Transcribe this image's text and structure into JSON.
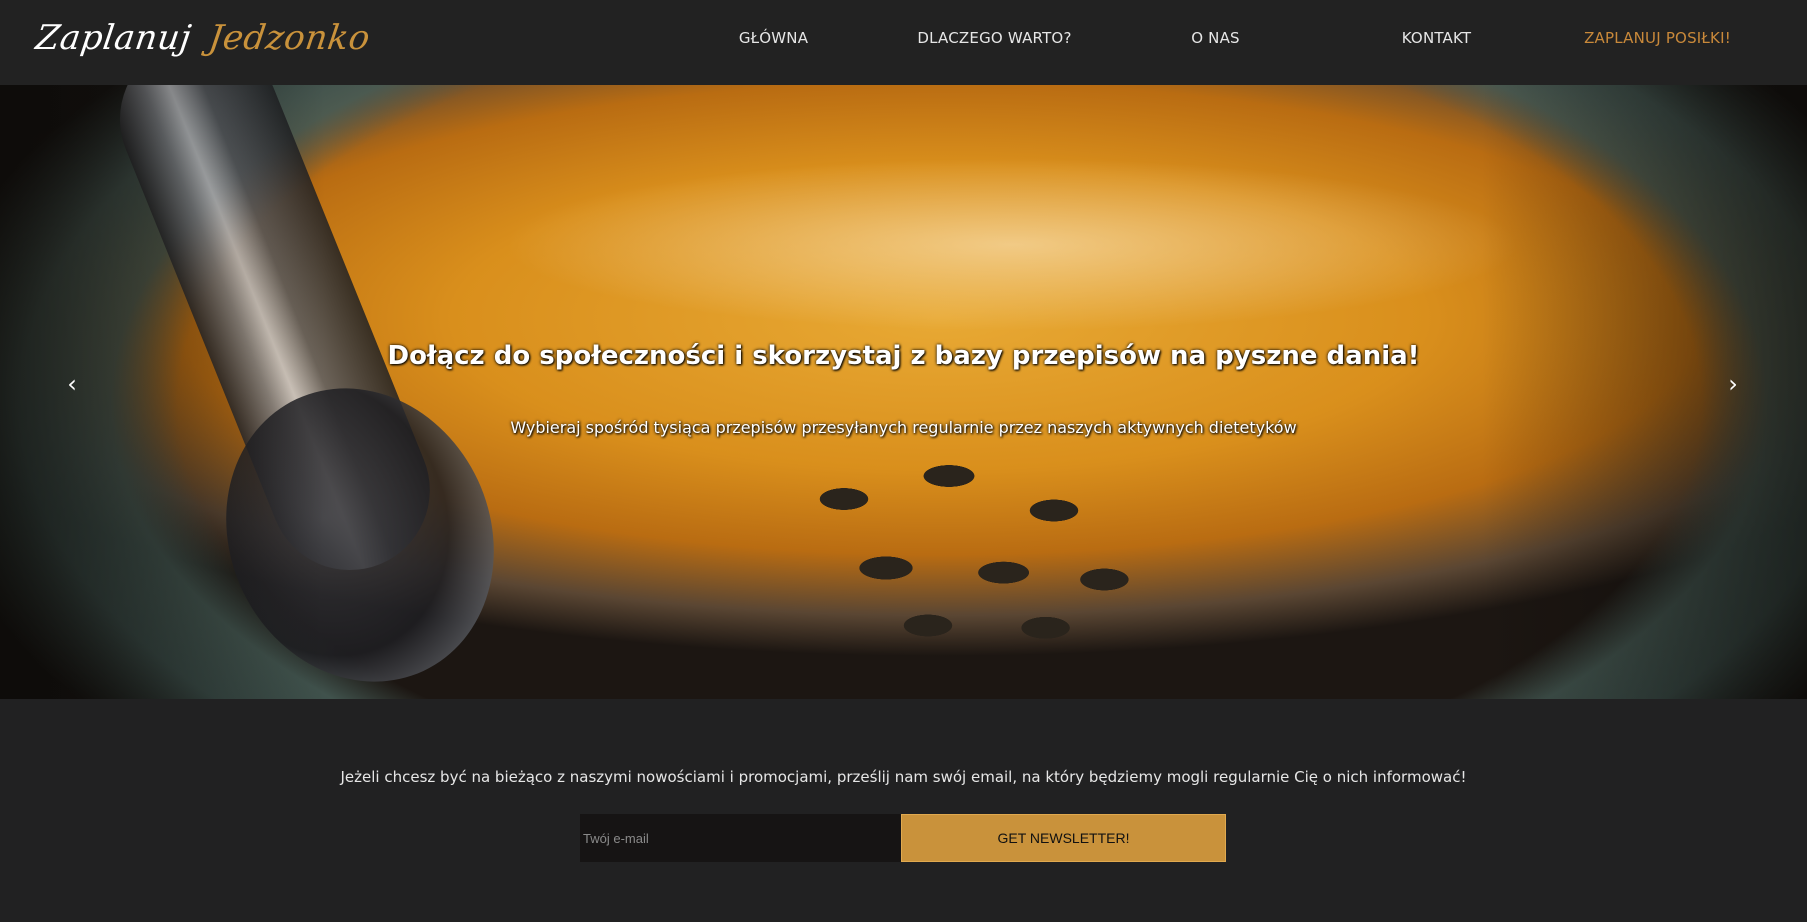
{
  "logo": {
    "word1": "Zaplanuj",
    "word2": "Jedzonko"
  },
  "nav": {
    "items": [
      {
        "label": "GŁÓWNA"
      },
      {
        "label": "DLACZEGO WARTO?"
      },
      {
        "label": "O NAS"
      },
      {
        "label": "KONTAKT"
      },
      {
        "label": "ZAPLANUJ POSIŁKI!"
      }
    ]
  },
  "hero": {
    "title": "Dołącz do społeczności i skorzystaj z bazy przepisów na pyszne dania!",
    "subtitle": "Wybieraj spośród tysiąca przepisów przesyłanych regularnie przez naszych aktywnych dietetyków",
    "prev_icon": "chevron-left-icon",
    "next_icon": "chevron-right-icon"
  },
  "newsletter": {
    "text": "Jeżeli chcesz być na bieżąco z naszymi nowościami i promocjami, prześlij nam swój email, na który będziemy mogli regularnie Cię o nich informować!",
    "email_placeholder": "Twój e-mail",
    "email_value": "",
    "button_label": "GET NEWSLETTER!"
  },
  "colors": {
    "background": "#212122",
    "accent": "#c9923b",
    "nav_text": "#e6e6e6"
  }
}
